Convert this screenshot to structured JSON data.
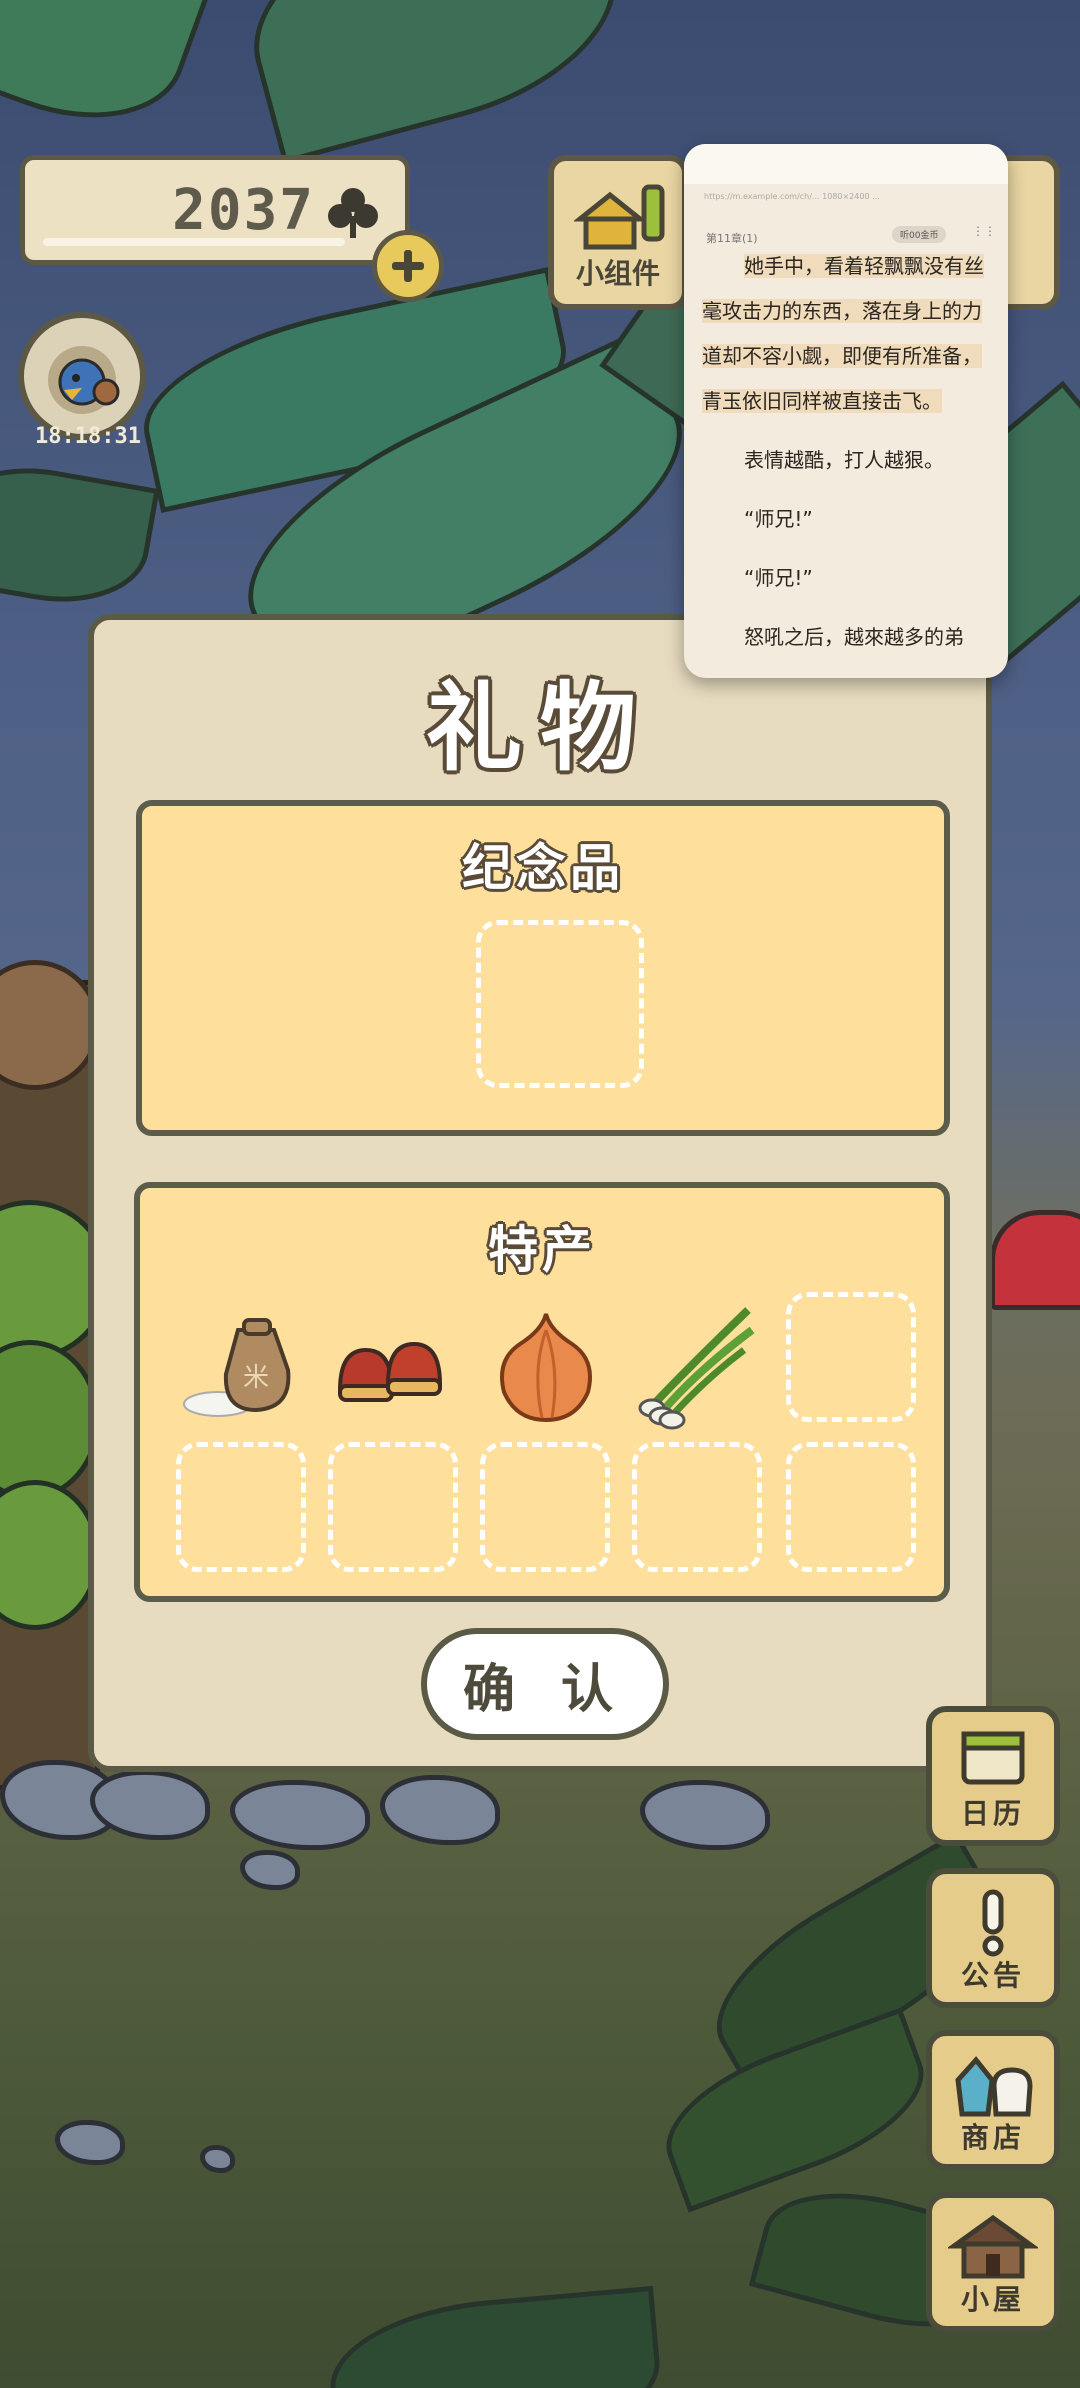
{
  "hud": {
    "clover_count": "2037",
    "timer": "18:18:31",
    "widget_label": "小组件"
  },
  "dialog": {
    "title": "礼物",
    "souvenir_title": "纪念品",
    "specialty_title": "特产",
    "specialty_items": [
      {
        "icon": "rice-sack-icon"
      },
      {
        "icon": "chestnut-icon"
      },
      {
        "icon": "onion-icon"
      },
      {
        "icon": "green-onion-icon"
      }
    ],
    "confirm_label": "确 认"
  },
  "side_buttons": [
    {
      "label": "日历",
      "icon": "calendar-icon"
    },
    {
      "label": "公告",
      "icon": "notice-icon"
    },
    {
      "label": "商店",
      "icon": "shop-icon"
    },
    {
      "label": "小屋",
      "icon": "house-icon"
    }
  ],
  "reader": {
    "url": "https://m.example.com/ch/... 1080×2400 ...",
    "chapter": "第11章(1)",
    "pill": "听00金币",
    "lines": [
      "她手中，看着轻飘飘没有丝毫攻击力的东西，落在身上的力道却不容小觑，即便有所准备，青玉依旧同样被直接击飞。",
      "表情越酷，打人越狠。",
      "“师兄!”",
      "“师兄!”",
      "怒吼之后，越來越多的弟"
    ]
  },
  "colors": {
    "panel_bg": "#e7dcc0",
    "section_bg": "#fedf9c",
    "outline": "#5a5a46"
  }
}
